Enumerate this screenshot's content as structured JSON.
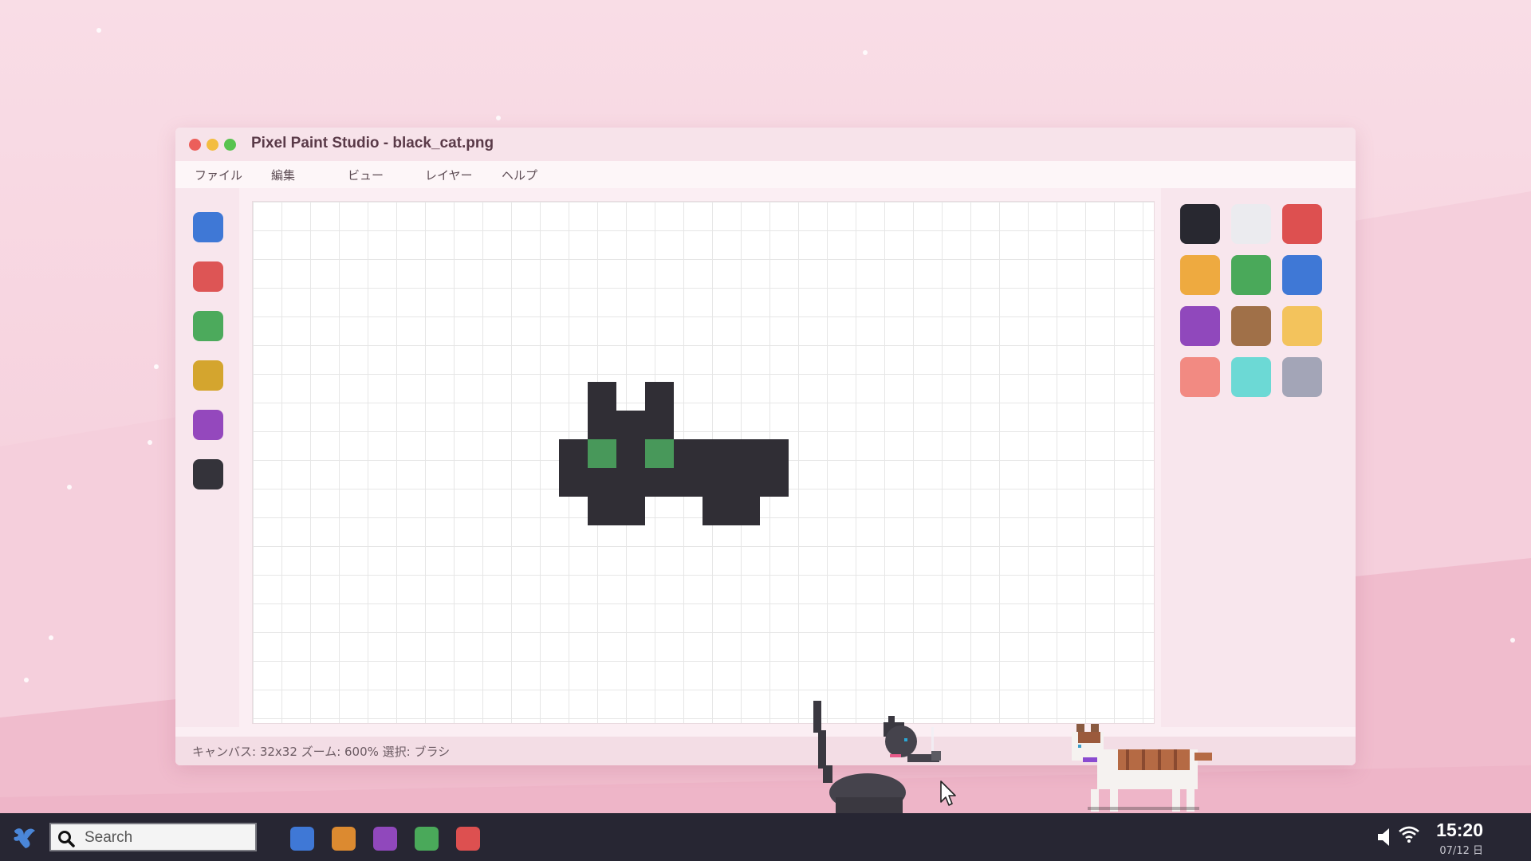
{
  "window": {
    "title": "Pixel Paint Studio - black_cat.png",
    "menu": [
      "ファイル",
      "編集",
      "ビュー",
      "レイヤー",
      "ヘルプ"
    ],
    "status": "キャンバス: 32x32  ズーム: 600%  選択: ブラシ"
  },
  "tools": [
    {
      "name": "tool-blue",
      "color": "#3f78d6"
    },
    {
      "name": "tool-red",
      "color": "#dd5555"
    },
    {
      "name": "tool-green",
      "color": "#4caa5c"
    },
    {
      "name": "tool-gold",
      "color": "#d4a52e"
    },
    {
      "name": "tool-purple",
      "color": "#9448bd"
    },
    {
      "name": "tool-dark",
      "color": "#34333a"
    }
  ],
  "palette": [
    "#282830",
    "#ebebef",
    "#dd5050",
    "#eeaa40",
    "#4aa95a",
    "#3f78d6",
    "#9048bc",
    "#a07048",
    "#f3c35c",
    "#f28a82",
    "#6cd9d5",
    "#a3a5b7"
  ],
  "taskbar": {
    "search_placeholder": "Search",
    "apps": [
      {
        "name": "app-blue",
        "color": "#3f78d6"
      },
      {
        "name": "app-orange",
        "color": "#dc8a30"
      },
      {
        "name": "app-purple",
        "color": "#9048bc"
      },
      {
        "name": "app-green",
        "color": "#4aa95a"
      },
      {
        "name": "app-red",
        "color": "#dd5050"
      }
    ],
    "clock": "15:20",
    "date": "07/12 日"
  },
  "icons": {
    "logo": "bird-logo-icon",
    "search": "search-icon",
    "volume": "volume-icon",
    "wifi": "wifi-icon",
    "cursor": "mouse-pointer-icon"
  },
  "colors": {
    "cat_body": "#302e35",
    "cat_eyes": "#48985a"
  }
}
